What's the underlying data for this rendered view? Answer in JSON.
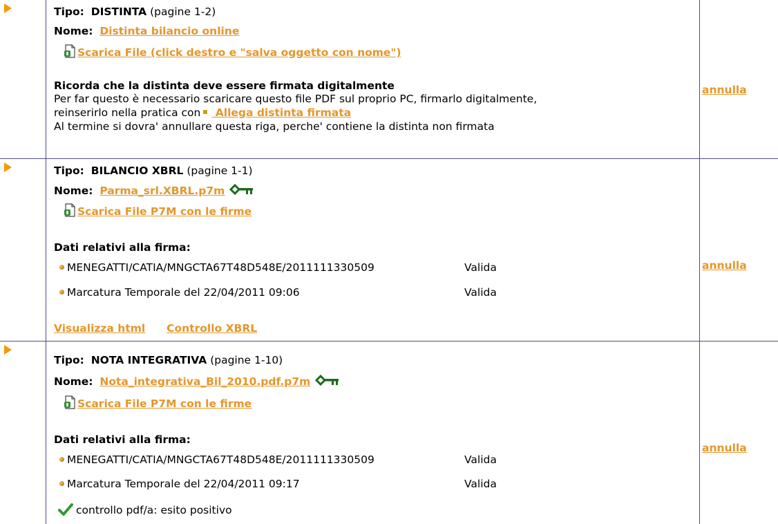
{
  "colors": {
    "link": "#e4972c",
    "border": "#4b4b88",
    "arrow": "#f59a00",
    "key": "#1c6b1c",
    "check": "#2e9a2e"
  },
  "rows": [
    {
      "tipo_label": "Tipo:",
      "tipo_value": "DISTINTA",
      "tipo_pages": "(pagine 1-2)",
      "nome_label": "Nome:",
      "nome_link": " Distinta bilancio online",
      "download_link": "Scarica File (click destro e \"salva oggetto con nome\")",
      "reminder_title": "Ricorda che la distinta deve essere firmata digitalmente",
      "reminder_line1": "Per far questo è necessario scaricare questo file PDF sul proprio PC, firmarlo digitalmente,",
      "reminder_line2_prefix": "reinserirlo nella pratica con",
      "reminder_line2_link": " Allega distinta firmata",
      "reminder_line3": "Al termine si dovra' annullare questa riga, perche' contiene la distinta non firmata",
      "annulla": "annulla"
    },
    {
      "tipo_label": "Tipo:",
      "tipo_value": "BILANCIO XBRL",
      "tipo_pages": "(pagine 1-1)",
      "nome_label": "Nome:",
      "nome_link": " Parma_srl.XBRL.p7m",
      "download_link": "Scarica File P7M con le firme",
      "signature_title": "Dati relativi alla firma:",
      "signatures": [
        {
          "text": "MENEGATTI/CATIA/MNGCTA67T48D548E/2011111330509",
          "status": "Valida"
        },
        {
          "text": "Marcatura Temporale del 22/04/2011 09:06",
          "status": "Valida"
        }
      ],
      "action_html": "Visualizza html",
      "action_xbrl": "Controllo XBRL",
      "annulla": "annulla"
    },
    {
      "tipo_label": "Tipo:",
      "tipo_value": "NOTA INTEGRATIVA",
      "tipo_pages": "(pagine 1-10)",
      "nome_label": "Nome:",
      "nome_link": " Nota_integrativa_Bil_2010.pdf.p7m",
      "download_link": "Scarica File P7M con le firme",
      "signature_title": "Dati relativi alla firma:",
      "signatures": [
        {
          "text": "MENEGATTI/CATIA/MNGCTA67T48D548E/2011111330509",
          "status": "Valida"
        },
        {
          "text": "Marcatura Temporale del 22/04/2011 09:17",
          "status": "Valida"
        }
      ],
      "pdfa_check": "controllo pdf/a: esito positivo",
      "annulla": "annulla"
    }
  ]
}
